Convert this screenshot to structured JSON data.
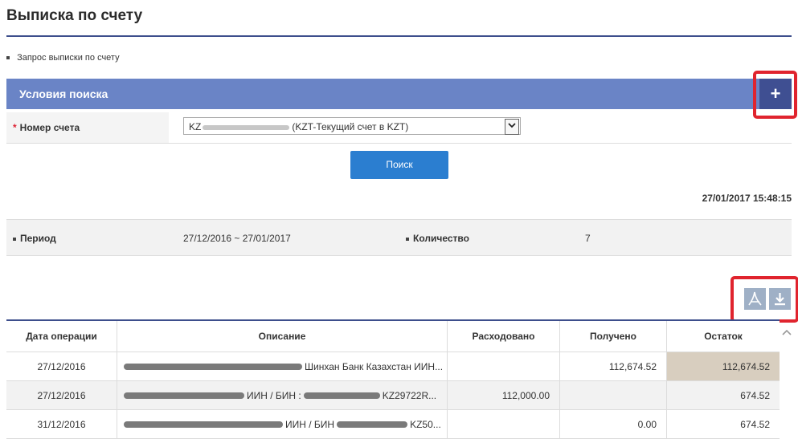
{
  "page": {
    "title": "Выписка по счету",
    "request_link": "Запрос выписки по счету"
  },
  "conditions": {
    "title": "Условия поиска",
    "toggle_label": "+",
    "account_label": "Номер счета",
    "account_required_mark": "*",
    "account_value_prefix": "KZ",
    "account_value_suffix": "(KZT-Текущий счет в KZT)",
    "search_label": "Поиск"
  },
  "summary": {
    "timestamp": "27/01/2017 15:48:15",
    "period_label": "Период",
    "period_value": "27/12/2016 ~ 27/01/2017",
    "count_label": "Количество",
    "count_value": "7"
  },
  "table": {
    "headers": [
      "Дата операции",
      "Описание",
      "Расходовано",
      "Получено",
      "Остаток"
    ],
    "rows": [
      {
        "date": "27/12/2016",
        "desc_text": "Шинхан Банк Казахстан ИИН...",
        "spent": "",
        "received": "112,674.52",
        "balance": "112,674.52"
      },
      {
        "date": "27/12/2016",
        "desc_text": "ИИН / БИН :",
        "desc_tail": "KZ29722R...",
        "spent": "112,000.00",
        "received": "",
        "balance": "674.52"
      },
      {
        "date": "31/12/2016",
        "desc_text": "ИИН / БИН",
        "desc_tail": "KZ50...",
        "spent": "",
        "received": "0.00",
        "balance": "674.52"
      }
    ]
  },
  "icons": {
    "pdf": "pdf-icon",
    "download": "download-icon",
    "scroll": "chevron-up-icon"
  },
  "colors": {
    "header_bar": "#6a84c6",
    "title_rule": "#3d4e8c",
    "search_button": "#2b7ed0",
    "annotation_red": "#e0242e",
    "balance_highlight": "#d8cebf"
  }
}
